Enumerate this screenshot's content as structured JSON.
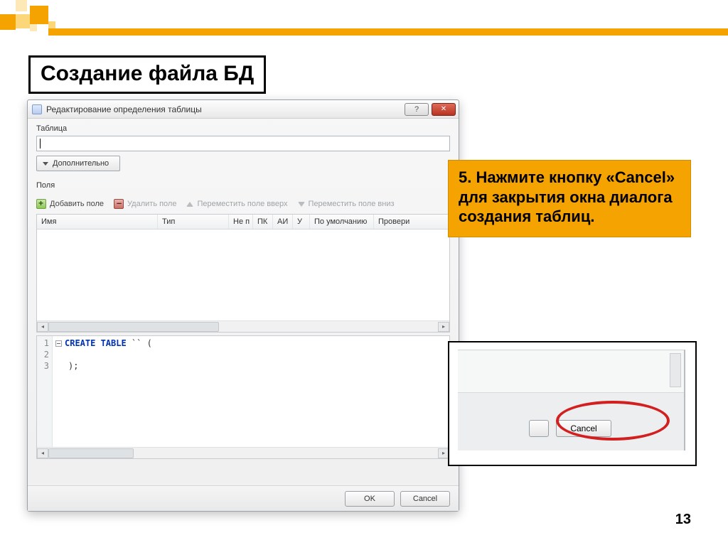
{
  "slide": {
    "title": "Создание файла БД",
    "page_number": "13"
  },
  "callout": {
    "text": "5. Нажмите кнопку «Cancel» для закрытия окна диалога создания таблиц."
  },
  "dialog": {
    "title": "Редактирование определения таблицы",
    "section_table": "Таблица",
    "advanced_btn": "Дополнительно",
    "section_fields": "Поля",
    "toolbar": {
      "add": "Добавить поле",
      "del": "Удалить поле",
      "up": "Переместить поле вверх",
      "down": "Переместить поле вниз"
    },
    "columns": {
      "name": "Имя",
      "type": "Тип",
      "notnull": "Не п",
      "pk": "ПК",
      "ai": "АИ",
      "u": "У",
      "default": "По умолчанию",
      "check": "Провери"
    },
    "sql": {
      "line1a": "CREATE TABLE",
      "line1b": " `` (",
      "line3": ");"
    },
    "footer": {
      "ok": "OK",
      "cancel": "Cancel"
    }
  },
  "inset": {
    "cancel": "Cancel"
  }
}
